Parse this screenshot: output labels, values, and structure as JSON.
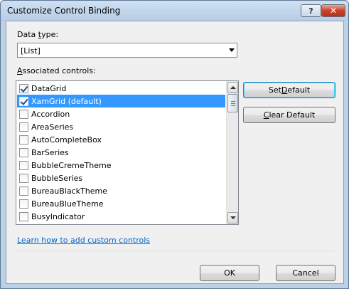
{
  "window": {
    "title": "Customize Control Binding"
  },
  "titlebar": {
    "help_glyph": "?",
    "close_glyph": "✕"
  },
  "data_type": {
    "label_pre": "Data ",
    "label_key": "t",
    "label_post": "ype:",
    "value": "[List]"
  },
  "associated": {
    "label_key": "A",
    "label_post": "ssociated controls:"
  },
  "controls": [
    {
      "label": "DataGrid",
      "checked": true,
      "selected": false
    },
    {
      "label": "XamGrid (default)",
      "checked": true,
      "selected": true
    },
    {
      "label": "Accordion",
      "checked": false,
      "selected": false
    },
    {
      "label": "AreaSeries",
      "checked": false,
      "selected": false
    },
    {
      "label": "AutoCompleteBox",
      "checked": false,
      "selected": false
    },
    {
      "label": "BarSeries",
      "checked": false,
      "selected": false
    },
    {
      "label": "BubbleCremeTheme",
      "checked": false,
      "selected": false
    },
    {
      "label": "BubbleSeries",
      "checked": false,
      "selected": false
    },
    {
      "label": "BureauBlackTheme",
      "checked": false,
      "selected": false
    },
    {
      "label": "BureauBlueTheme",
      "checked": false,
      "selected": false
    },
    {
      "label": "BusyIndicator",
      "checked": false,
      "selected": false
    }
  ],
  "buttons": {
    "set_default_pre": "Set ",
    "set_default_key": "D",
    "set_default_post": "efault",
    "clear_default_key": "C",
    "clear_default_post": "lear Default",
    "ok": "OK",
    "cancel": "Cancel"
  },
  "link": {
    "text": "Learn how to add custom controls"
  }
}
